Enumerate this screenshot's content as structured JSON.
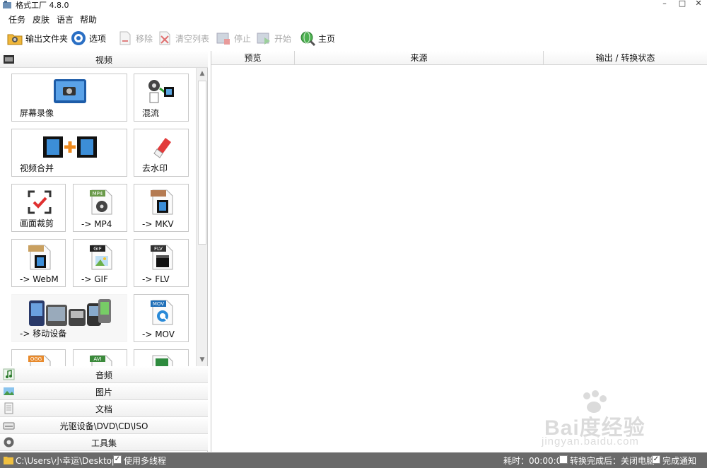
{
  "window": {
    "title": "格式工厂 4.8.0",
    "minimize": "–",
    "maximize": "□",
    "close": "✕"
  },
  "menu": [
    "任务",
    "皮肤",
    "语言",
    "帮助"
  ],
  "toolbar": {
    "output_folder": "输出文件夹",
    "options": "选项",
    "remove": "移除",
    "clear_list": "清空列表",
    "stop": "停止",
    "start": "开始",
    "home": "主页"
  },
  "categories": {
    "video": "视频",
    "audio": "音频",
    "picture": "图片",
    "document": "文档",
    "optical": "光驱设备\\DVD\\CD\\ISO",
    "tools": "工具集"
  },
  "tiles": {
    "screen_record": "屏幕录像",
    "mux": "混流",
    "video_join": "视频合并",
    "remove_watermark": "去水印",
    "crop": "画面裁剪",
    "mp4": "-> MP4",
    "mkv": "-> MKV",
    "webm": "-> WebM",
    "gif": "-> GIF",
    "flv": "-> FLV",
    "mobile": "-> 移动设备",
    "mov": "-> MOV"
  },
  "file_badges": {
    "mp4": "MP4",
    "gif": "GIF",
    "flv": "FLV",
    "mov": "MOV",
    "avi": "AVI",
    "ogg": "OGG"
  },
  "columns": [
    "预览",
    "来源",
    "输出 / 转换状态"
  ],
  "watermark": {
    "brand": "Bai度经验",
    "url": "jingyan.baidu.com"
  },
  "status": {
    "path": "C:\\Users\\小幸运\\Desktop",
    "multithread": "使用多线程",
    "elapsed": "耗时：00:00:00",
    "after_done": "转换完成后：关闭电脑",
    "notify": "完成通知"
  }
}
